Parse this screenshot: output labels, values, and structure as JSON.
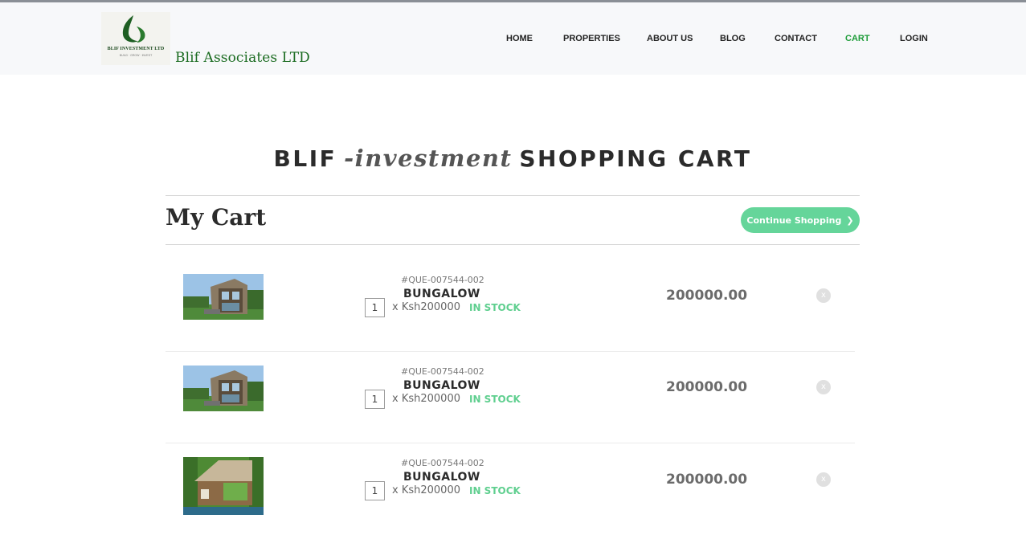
{
  "header": {
    "logo_text": "BLIF INVESTMENT LTD",
    "logo_tagline": "BUILD · GROW · INVEST",
    "brand": "Blif Associates LTD",
    "nav": [
      {
        "label": "HOME",
        "active": false
      },
      {
        "label": "PROPERTIES",
        "active": false
      },
      {
        "label": "ABOUT US",
        "active": false
      },
      {
        "label": "BLOG",
        "active": false
      },
      {
        "label": "CONTACT",
        "active": false
      },
      {
        "label": "CART",
        "active": true
      },
      {
        "label": "LOGIN",
        "active": false
      }
    ]
  },
  "page": {
    "title_part1": "BLIF",
    "title_part2": "-investment",
    "title_part3": "SHOPPING CART",
    "section_title": "My Cart",
    "continue_label": "Continue Shopping",
    "continue_icon": "chevron-right-icon"
  },
  "cart": {
    "items": [
      {
        "sku": "#QUE-007544-002",
        "name": "BUNGALOW",
        "qty": "1",
        "unit_price": "x Ksh200000",
        "stock": "IN STOCK",
        "total": "200000.00",
        "remove": "x"
      },
      {
        "sku": "#QUE-007544-002",
        "name": "BUNGALOW",
        "qty": "1",
        "unit_price": "x Ksh200000",
        "stock": "IN STOCK",
        "total": "200000.00",
        "remove": "x"
      },
      {
        "sku": "#QUE-007544-002",
        "name": "BUNGALOW",
        "qty": "1",
        "unit_price": "x Ksh200000",
        "stock": "IN STOCK",
        "total": "200000.00",
        "remove": "x"
      }
    ]
  },
  "colors": {
    "brand_green": "#1a6b20",
    "active_nav": "#1f9d3a",
    "button_green": "#65d59a",
    "stock_green": "#5fcf8f"
  }
}
